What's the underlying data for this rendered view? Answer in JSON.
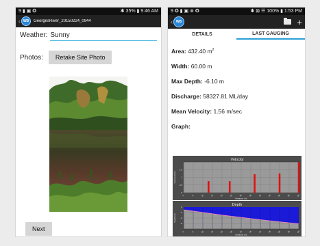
{
  "left_screen": {
    "status": {
      "left": "9 ▮ ▣ ✪",
      "right": "✱ 35% ▮ 9:46 AM"
    },
    "app_title": "GeorgesRiver_20150224_0944",
    "logo_text": "WB",
    "weather_label": "Weather:",
    "weather_value": "Sunny",
    "photos_label": "Photos:",
    "retake_button": "Retake Site Photo",
    "next_button": "Next"
  },
  "right_screen": {
    "status": {
      "left": "9 ✪ ▮ ▣ ⊗ ✪",
      "right": "✱ ⊠ ☰ 100% ▮ 1:53 PM"
    },
    "logo_text": "WB",
    "tabs": [
      {
        "label": "DETAILS"
      },
      {
        "label": "LAST GAUGING"
      }
    ],
    "metrics": {
      "area_label": "Area:",
      "area_value": "432.40 m",
      "area_unit_sup": "2",
      "width_label": "Width:",
      "width_value": "60.00 m",
      "max_depth_label": "Max Depth:",
      "max_depth_value": "-6.10 m",
      "discharge_label": "Discharge:",
      "discharge_value": "58327.81 ML/day",
      "velocity_label": "Mean Velocity:",
      "velocity_value": "1.56 m/sec"
    },
    "graph_label": "Graph:"
  },
  "chart_data": [
    {
      "type": "bar",
      "title": "Velocity",
      "xlabel": "Distance (m)",
      "ylabel": "Velocity (m/s)",
      "ylim": [
        0,
        2
      ],
      "yticks": [
        "0",
        "0.5",
        "1",
        "1.5"
      ],
      "xticks": [
        "0",
        "5",
        "10",
        "15",
        "20",
        "25",
        "30",
        "35",
        "40",
        "45",
        "50",
        "55",
        "60"
      ],
      "x": [
        13,
        24,
        37,
        50,
        60
      ],
      "values": [
        0.75,
        0.75,
        1.2,
        1.25,
        2.0
      ],
      "bar_color": "#e01010",
      "background": "#9a9a9a",
      "grid": true
    },
    {
      "type": "area",
      "title": "Depth",
      "xlabel": "Distance (m)",
      "ylabel": "Depth (m)",
      "ylim": [
        -8,
        0
      ],
      "yticks": [
        "0",
        "-2",
        "-4",
        "-6"
      ],
      "xticks": [
        "0",
        "5",
        "10",
        "15",
        "20",
        "25",
        "30",
        "35",
        "40",
        "45",
        "50",
        "55",
        "60"
      ],
      "x": [
        0,
        60
      ],
      "values": [
        -1,
        -6.1
      ],
      "fill_color": "#1a1ad8",
      "line_color": "#ff80c0",
      "background": "#9a9a9a",
      "grid": true
    }
  ]
}
